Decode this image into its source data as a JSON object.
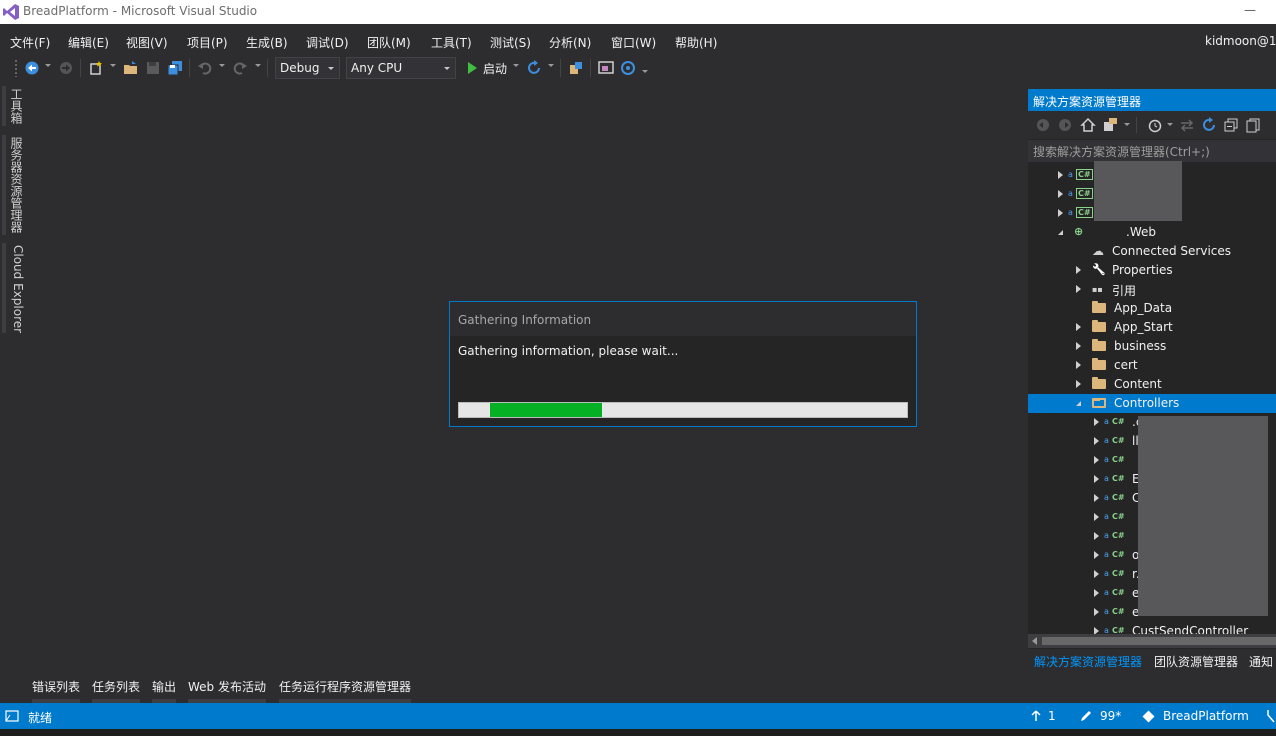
{
  "window": {
    "title": "BreadPlatform - Microsoft Visual Studio",
    "minimize_glyph": "—"
  },
  "menu": [
    "文件(F)",
    "编辑(E)",
    "视图(V)",
    "项目(P)",
    "生成(B)",
    "调试(D)",
    "团队(M)",
    "工具(T)",
    "测试(S)",
    "分析(N)",
    "窗口(W)",
    "帮助(H)"
  ],
  "user": "kidmoon@1",
  "toolbar": {
    "configuration": "Debug",
    "platform": "Any CPU",
    "run_label": "启动",
    "icons": [
      "back-icon",
      "forward-icon",
      "new-project-icon",
      "open-file-icon",
      "save-icon",
      "save-all-icon",
      "undo-icon",
      "redo-icon",
      "start-icon",
      "refresh-icon",
      "find-icon",
      "browser-link-icon"
    ]
  },
  "left_tabs": [
    "工具箱",
    "服务器资源管理器",
    "Cloud Explorer"
  ],
  "dialog": {
    "title": "Gathering Information",
    "message": "Gathering information, please wait...",
    "progress_fill_start": 0.07,
    "progress_fill_end": 0.32
  },
  "solution_explorer": {
    "title": "解决方案资源管理器",
    "search_placeholder": "搜索解决方案资源管理器(Ctrl+;)",
    "items": [
      {
        "indent": 0,
        "expander": "collapsed",
        "icon": "csharp-project",
        "label": ""
      },
      {
        "indent": 0,
        "expander": "collapsed",
        "icon": "csharp-project",
        "label": ""
      },
      {
        "indent": 0,
        "expander": "collapsed",
        "icon": "csharp-project",
        "label": ""
      },
      {
        "indent": 0,
        "expander": "expanded",
        "icon": "web-project",
        "label": ".Web"
      },
      {
        "indent": 1,
        "expander": "none",
        "icon": "connected-services",
        "label": "Connected Services"
      },
      {
        "indent": 1,
        "expander": "collapsed",
        "icon": "wrench",
        "label": "Properties"
      },
      {
        "indent": 1,
        "expander": "collapsed",
        "icon": "references",
        "label": "引用"
      },
      {
        "indent": 1,
        "expander": "none",
        "icon": "folder",
        "label": "App_Data"
      },
      {
        "indent": 1,
        "expander": "collapsed",
        "icon": "folder",
        "label": "App_Start"
      },
      {
        "indent": 1,
        "expander": "collapsed",
        "icon": "folder",
        "label": "business"
      },
      {
        "indent": 1,
        "expander": "collapsed",
        "icon": "folder",
        "label": "cert"
      },
      {
        "indent": 1,
        "expander": "collapsed",
        "icon": "folder",
        "label": "Content"
      },
      {
        "indent": 1,
        "expander": "expanded",
        "icon": "folder-open",
        "label": "Controllers",
        "selected": true
      },
      {
        "indent": 2,
        "expander": "collapsed",
        "icon": "csharp-file",
        "label": ".cs"
      },
      {
        "indent": 2,
        "expander": "collapsed",
        "icon": "csharp-file",
        "label": "ll"
      },
      {
        "indent": 2,
        "expander": "collapsed",
        "icon": "csharp-file",
        "label": ""
      },
      {
        "indent": 2,
        "expander": "collapsed",
        "icon": "csharp-file",
        "label": "E"
      },
      {
        "indent": 2,
        "expander": "collapsed",
        "icon": "csharp-file",
        "label": "C"
      },
      {
        "indent": 2,
        "expander": "collapsed",
        "icon": "csharp-file",
        "label": ""
      },
      {
        "indent": 2,
        "expander": "collapsed",
        "icon": "csharp-file",
        "label": ""
      },
      {
        "indent": 2,
        "expander": "collapsed",
        "icon": "csharp-file",
        "label": "ol"
      },
      {
        "indent": 2,
        "expander": "collapsed",
        "icon": "csharp-file",
        "label": "r.cs"
      },
      {
        "indent": 2,
        "expander": "collapsed",
        "icon": "csharp-file",
        "label": "er.cs"
      },
      {
        "indent": 2,
        "expander": "collapsed",
        "icon": "csharp-file",
        "label": "er.cs"
      },
      {
        "indent": 2,
        "expander": "collapsed",
        "icon": "csharp-file",
        "label": "CustSendController"
      }
    ],
    "tabs": [
      "解决方案资源管理器",
      "团队资源管理器",
      "通知"
    ]
  },
  "bottom_tabs": [
    "错误列表",
    "任务列表",
    "输出",
    "Web 发布活动",
    "任务运行程序资源管理器"
  ],
  "status": {
    "state": "就绪",
    "up_count": "1",
    "edit_count": "99*",
    "repo": "BreadPlatform"
  }
}
